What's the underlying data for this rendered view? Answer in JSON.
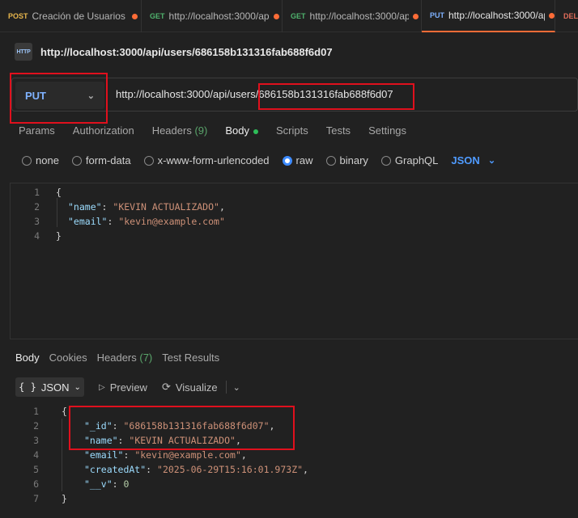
{
  "tabs": [
    {
      "method": "POST",
      "title": "Creación de Usuarios ("
    },
    {
      "method": "GET",
      "title": "http://localhost:3000/ap"
    },
    {
      "method": "GET",
      "title": "http://localhost:3000/ap"
    },
    {
      "method": "PUT",
      "title": "http://localhost:3000/ap"
    },
    {
      "method": "DEL",
      "title": ""
    }
  ],
  "request": {
    "icon_label": "HTTP",
    "title": "http://localhost:3000/api/users/686158b131316fab688f6d07",
    "method": "PUT",
    "url": "http://localhost:3000/api/users/686158b131316fab688f6d07"
  },
  "request_tabs": {
    "params": "Params",
    "authorization": "Authorization",
    "headers": "Headers",
    "headers_count": "(9)",
    "body": "Body",
    "scripts": "Scripts",
    "tests": "Tests",
    "settings": "Settings"
  },
  "body_types": {
    "none": "none",
    "form_data": "form-data",
    "urlencoded": "x-www-form-urlencoded",
    "raw": "raw",
    "binary": "binary",
    "graphql": "GraphQL",
    "selected": "raw",
    "language": "JSON"
  },
  "request_body": {
    "line_numbers": [
      "1",
      "2",
      "3",
      "4"
    ],
    "open": "{",
    "name_key": "\"name\"",
    "name_value": "\"KEVIN ACTUALIZADO\"",
    "email_key": "\"email\"",
    "email_value": "\"kevin@example.com\"",
    "close": "}"
  },
  "response_tabs": {
    "body": "Body",
    "cookies": "Cookies",
    "headers": "Headers",
    "headers_count": "(7)",
    "test_results": "Test Results"
  },
  "response_toolbar": {
    "format": "JSON",
    "preview": "Preview",
    "visualize": "Visualize"
  },
  "response_body": {
    "line_numbers": [
      "1",
      "2",
      "3",
      "4",
      "5",
      "6",
      "7"
    ],
    "open": "{",
    "id_key": "\"_id\"",
    "id_value": "\"686158b131316fab688f6d07\"",
    "name_key": "\"name\"",
    "name_value": "\"KEVIN ACTUALIZADO\"",
    "email_key": "\"email\"",
    "email_value": "\"kevin@example.com\"",
    "created_key": "\"createdAt\"",
    "created_value": "\"2025-06-29T15:16:01.973Z\"",
    "v_key": "\"__v\"",
    "v_value": "0",
    "close": "}"
  },
  "colors": {
    "accent": "#ff6c37",
    "highlight": "#e0101d",
    "method_put": "#7fb2ff",
    "json_key": "#9cdcfe",
    "json_string": "#ce9178",
    "json_number": "#b5cea8"
  }
}
